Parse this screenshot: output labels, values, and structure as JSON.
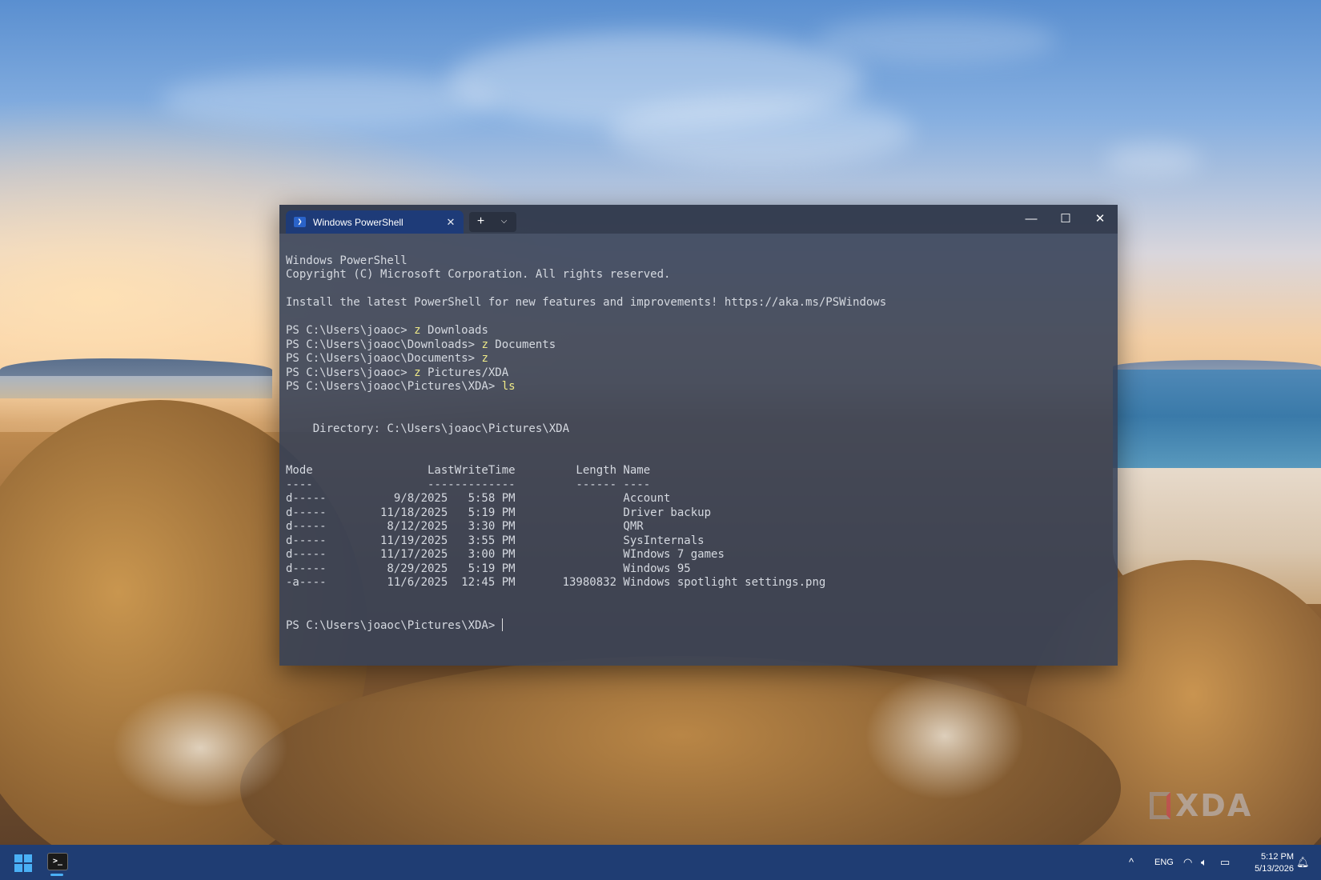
{
  "tab": {
    "title": "Windows PowerShell",
    "icon": "powershell-icon",
    "close": "✕"
  },
  "toolbar": {
    "new_tab": "+",
    "dropdown": "⌵"
  },
  "window_controls": {
    "minimize": "—",
    "maximize": "☐",
    "close": "✕"
  },
  "terminal": {
    "header": [
      "Windows PowerShell",
      "Copyright (C) Microsoft Corporation. All rights reserved.",
      "",
      "Install the latest PowerShell for new features and improvements! https://aka.ms/PSWindows",
      ""
    ],
    "commands": [
      {
        "prompt": "PS C:\\Users\\joaoc> ",
        "cmd": "z",
        "arg": " Downloads"
      },
      {
        "prompt": "PS C:\\Users\\joaoc\\Downloads> ",
        "cmd": "z",
        "arg": " Documents"
      },
      {
        "prompt": "PS C:\\Users\\joaoc\\Documents> ",
        "cmd": "z",
        "arg": ""
      },
      {
        "prompt": "PS C:\\Users\\joaoc> ",
        "cmd": "z",
        "arg": " Pictures/XDA"
      },
      {
        "prompt": "PS C:\\Users\\joaoc\\Pictures\\XDA> ",
        "cmd": "ls",
        "arg": ""
      }
    ],
    "directory_line": "    Directory: C:\\Users\\joaoc\\Pictures\\XDA",
    "table_header": "Mode                 LastWriteTime         Length Name",
    "table_rule": "----                 -------------         ------ ----",
    "rows": [
      "d-----          9/8/2025   5:58 PM                Account",
      "d-----        11/18/2025   5:19 PM                Driver backup",
      "d-----         8/12/2025   3:30 PM                QMR",
      "d-----        11/19/2025   3:55 PM                SysInternals",
      "d-----        11/17/2025   3:00 PM                WIndows 7 games",
      "d-----         8/29/2025   5:19 PM                Windows 95",
      "-a----         11/6/2025  12:45 PM       13980832 Windows spotlight settings.png"
    ],
    "final_prompt": "PS C:\\Users\\joaoc\\Pictures\\XDA> "
  },
  "watermark": {
    "text": "XDA"
  },
  "taskbar": {
    "start_icon": "windows-start-icon",
    "terminal_app_label": ">_",
    "tray": {
      "chevron": "^",
      "language": "ENG",
      "wifi": "wifi-icon",
      "volume": "volume-icon",
      "battery": "battery-icon"
    },
    "time": "5:12 PM",
    "date": "5/13/2026"
  }
}
